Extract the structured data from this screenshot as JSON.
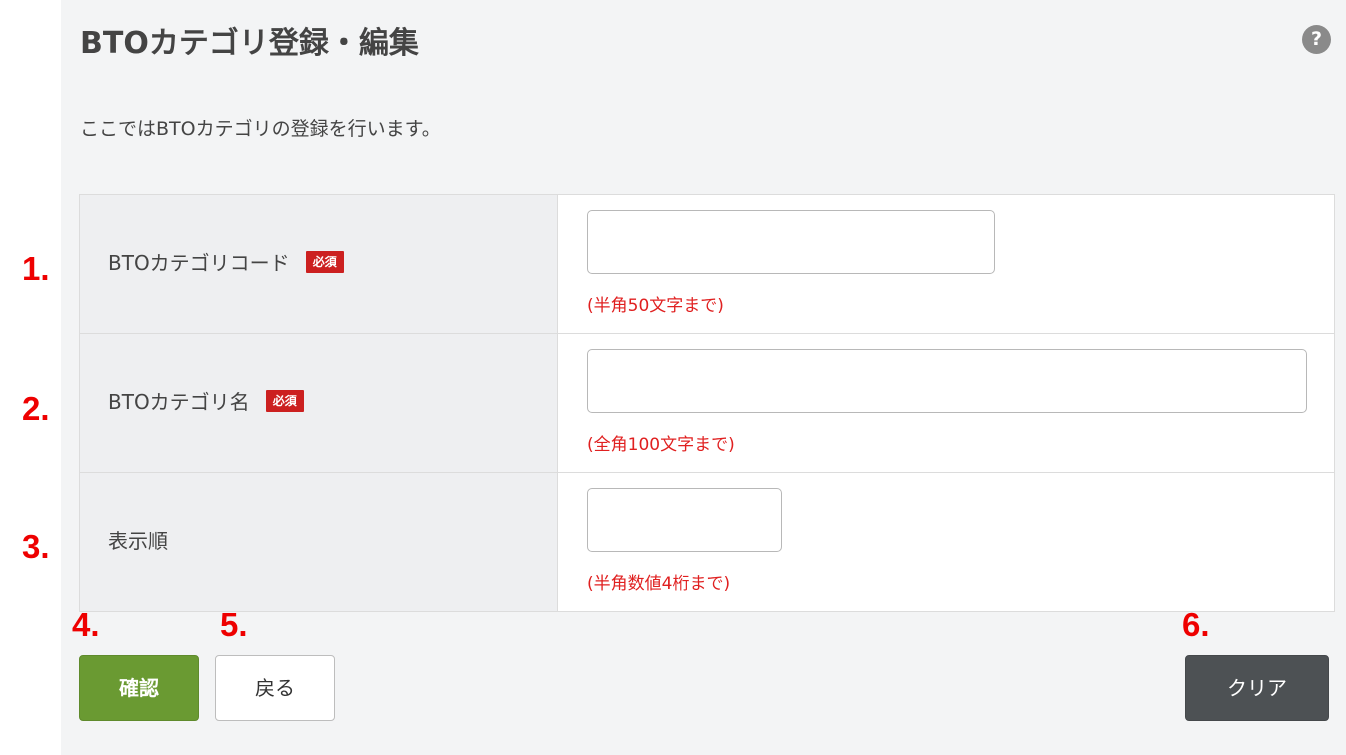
{
  "page": {
    "title": "BTOカテゴリ登録・編集",
    "description": "ここではBTOカテゴリの登録を行います。",
    "help_icon": "?"
  },
  "form": {
    "required_label": "必須",
    "rows": [
      {
        "label": "BTOカテゴリコード",
        "required": true,
        "value": "",
        "placeholder": "",
        "hint": "(半角50文字まで)"
      },
      {
        "label": "BTOカテゴリ名",
        "required": true,
        "value": "",
        "placeholder": "",
        "hint": "(全角100文字まで)"
      },
      {
        "label": "表示順",
        "required": false,
        "value": "",
        "placeholder": "",
        "hint": "(半角数値4桁まで)"
      }
    ]
  },
  "buttons": {
    "confirm": "確認",
    "back": "戻る",
    "clear": "クリア"
  },
  "annotations": [
    "1.",
    "2.",
    "3.",
    "4.",
    "5.",
    "6."
  ],
  "colors": {
    "confirm_bg": "#6a9a32",
    "clear_bg": "#4d5154",
    "required_bg": "#cc2020",
    "hint_text": "#e02020",
    "annotation": "#ee0000"
  }
}
